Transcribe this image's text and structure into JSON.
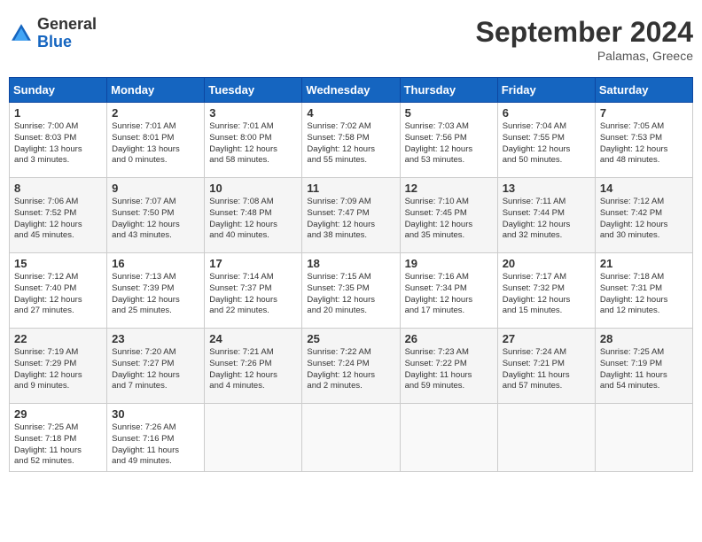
{
  "logo": {
    "general": "General",
    "blue": "Blue"
  },
  "header": {
    "month": "September 2024",
    "location": "Palamas, Greece"
  },
  "weekdays": [
    "Sunday",
    "Monday",
    "Tuesday",
    "Wednesday",
    "Thursday",
    "Friday",
    "Saturday"
  ],
  "weeks": [
    [
      {
        "day": "1",
        "sunrise": "7:00 AM",
        "sunset": "8:03 PM",
        "daylight": "13 hours and 3 minutes."
      },
      {
        "day": "2",
        "sunrise": "7:01 AM",
        "sunset": "8:01 PM",
        "daylight": "13 hours and 0 minutes."
      },
      {
        "day": "3",
        "sunrise": "7:01 AM",
        "sunset": "8:00 PM",
        "daylight": "12 hours and 58 minutes."
      },
      {
        "day": "4",
        "sunrise": "7:02 AM",
        "sunset": "7:58 PM",
        "daylight": "12 hours and 55 minutes."
      },
      {
        "day": "5",
        "sunrise": "7:03 AM",
        "sunset": "7:56 PM",
        "daylight": "12 hours and 53 minutes."
      },
      {
        "day": "6",
        "sunrise": "7:04 AM",
        "sunset": "7:55 PM",
        "daylight": "12 hours and 50 minutes."
      },
      {
        "day": "7",
        "sunrise": "7:05 AM",
        "sunset": "7:53 PM",
        "daylight": "12 hours and 48 minutes."
      }
    ],
    [
      {
        "day": "8",
        "sunrise": "7:06 AM",
        "sunset": "7:52 PM",
        "daylight": "12 hours and 45 minutes."
      },
      {
        "day": "9",
        "sunrise": "7:07 AM",
        "sunset": "7:50 PM",
        "daylight": "12 hours and 43 minutes."
      },
      {
        "day": "10",
        "sunrise": "7:08 AM",
        "sunset": "7:48 PM",
        "daylight": "12 hours and 40 minutes."
      },
      {
        "day": "11",
        "sunrise": "7:09 AM",
        "sunset": "7:47 PM",
        "daylight": "12 hours and 38 minutes."
      },
      {
        "day": "12",
        "sunrise": "7:10 AM",
        "sunset": "7:45 PM",
        "daylight": "12 hours and 35 minutes."
      },
      {
        "day": "13",
        "sunrise": "7:11 AM",
        "sunset": "7:44 PM",
        "daylight": "12 hours and 32 minutes."
      },
      {
        "day": "14",
        "sunrise": "7:12 AM",
        "sunset": "7:42 PM",
        "daylight": "12 hours and 30 minutes."
      }
    ],
    [
      {
        "day": "15",
        "sunrise": "7:12 AM",
        "sunset": "7:40 PM",
        "daylight": "12 hours and 27 minutes."
      },
      {
        "day": "16",
        "sunrise": "7:13 AM",
        "sunset": "7:39 PM",
        "daylight": "12 hours and 25 minutes."
      },
      {
        "day": "17",
        "sunrise": "7:14 AM",
        "sunset": "7:37 PM",
        "daylight": "12 hours and 22 minutes."
      },
      {
        "day": "18",
        "sunrise": "7:15 AM",
        "sunset": "7:35 PM",
        "daylight": "12 hours and 20 minutes."
      },
      {
        "day": "19",
        "sunrise": "7:16 AM",
        "sunset": "7:34 PM",
        "daylight": "12 hours and 17 minutes."
      },
      {
        "day": "20",
        "sunrise": "7:17 AM",
        "sunset": "7:32 PM",
        "daylight": "12 hours and 15 minutes."
      },
      {
        "day": "21",
        "sunrise": "7:18 AM",
        "sunset": "7:31 PM",
        "daylight": "12 hours and 12 minutes."
      }
    ],
    [
      {
        "day": "22",
        "sunrise": "7:19 AM",
        "sunset": "7:29 PM",
        "daylight": "12 hours and 9 minutes."
      },
      {
        "day": "23",
        "sunrise": "7:20 AM",
        "sunset": "7:27 PM",
        "daylight": "12 hours and 7 minutes."
      },
      {
        "day": "24",
        "sunrise": "7:21 AM",
        "sunset": "7:26 PM",
        "daylight": "12 hours and 4 minutes."
      },
      {
        "day": "25",
        "sunrise": "7:22 AM",
        "sunset": "7:24 PM",
        "daylight": "12 hours and 2 minutes."
      },
      {
        "day": "26",
        "sunrise": "7:23 AM",
        "sunset": "7:22 PM",
        "daylight": "11 hours and 59 minutes."
      },
      {
        "day": "27",
        "sunrise": "7:24 AM",
        "sunset": "7:21 PM",
        "daylight": "11 hours and 57 minutes."
      },
      {
        "day": "28",
        "sunrise": "7:25 AM",
        "sunset": "7:19 PM",
        "daylight": "11 hours and 54 minutes."
      }
    ],
    [
      {
        "day": "29",
        "sunrise": "7:25 AM",
        "sunset": "7:18 PM",
        "daylight": "11 hours and 52 minutes."
      },
      {
        "day": "30",
        "sunrise": "7:26 AM",
        "sunset": "7:16 PM",
        "daylight": "11 hours and 49 minutes."
      },
      null,
      null,
      null,
      null,
      null
    ]
  ],
  "labels": {
    "sunrise": "Sunrise:",
    "sunset": "Sunset:",
    "daylight": "Daylight hours"
  }
}
